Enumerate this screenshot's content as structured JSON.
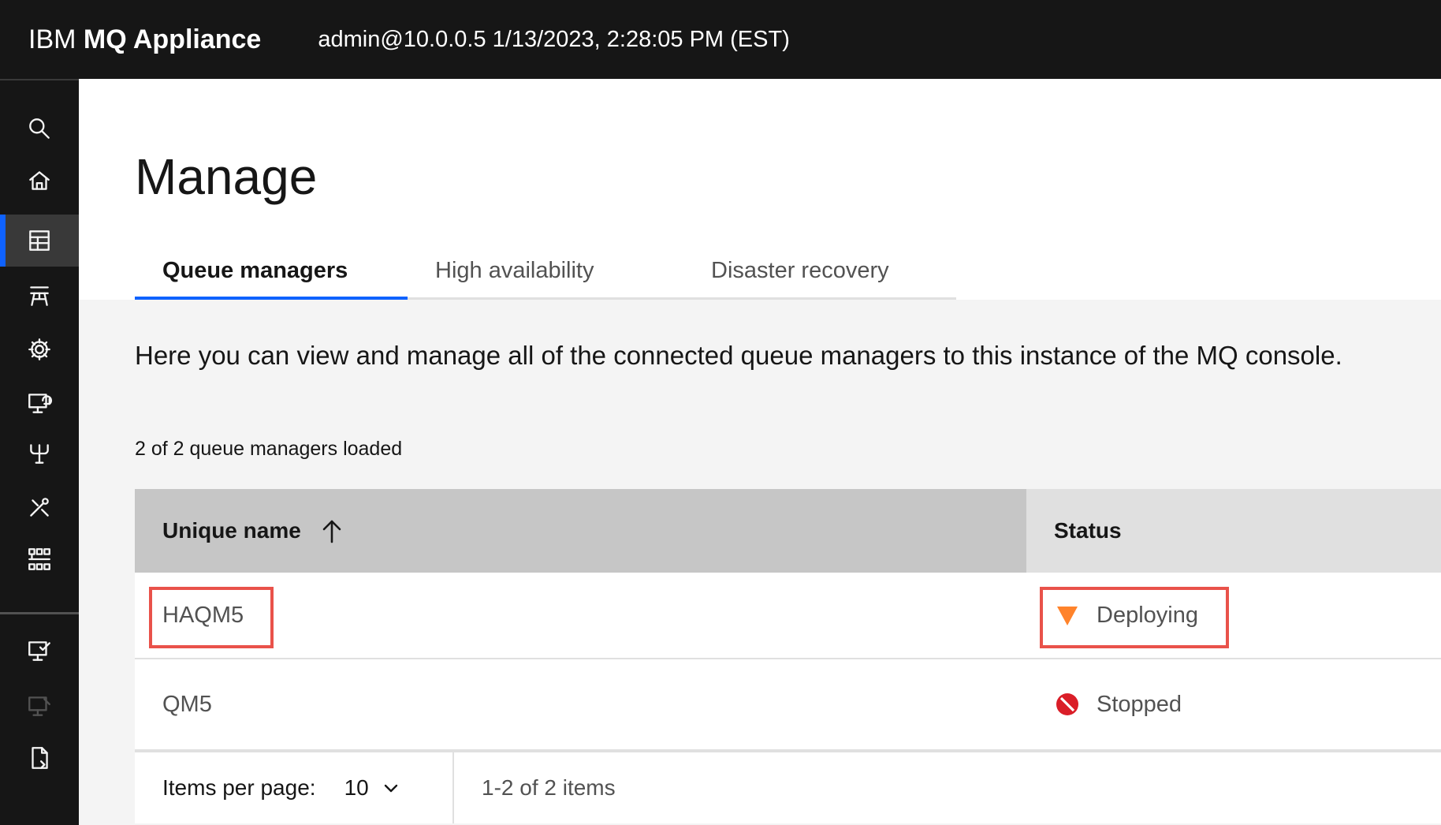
{
  "header": {
    "brand_prefix": "IBM",
    "brand_name": "MQ Appliance",
    "session": "admin@10.0.0.5 1/13/2023, 2:28:05 PM (EST)"
  },
  "sidenav": {
    "items": [
      {
        "icon": "search-icon"
      },
      {
        "icon": "home-icon"
      },
      {
        "icon": "table-icon",
        "active": true
      },
      {
        "icon": "network-icon"
      },
      {
        "icon": "gear-icon"
      },
      {
        "icon": "monitor-sync-icon"
      },
      {
        "icon": "fork-icon"
      },
      {
        "icon": "tools-icon"
      },
      {
        "icon": "topology-icon"
      },
      {
        "icon": "monitor-check-icon"
      },
      {
        "icon": "monitor-disabled-icon",
        "disabled": true
      },
      {
        "icon": "document-icon"
      }
    ]
  },
  "page": {
    "title": "Manage",
    "tabs": [
      "Queue managers",
      "High availability",
      "Disaster recovery"
    ],
    "description": "Here you can view and manage all of the connected queue managers to this instance of the MQ console.",
    "loaded_count": "2 of 2 queue managers loaded"
  },
  "table": {
    "columns": [
      "Unique name",
      "Status"
    ],
    "rows": [
      {
        "name": "HAQM5",
        "status": "Deploying",
        "status_color": "#ff832b"
      },
      {
        "name": "QM5",
        "status": "Stopped",
        "status_color": "#da1e28"
      }
    ],
    "items_per_page_label": "Items per page:",
    "items_per_page_value": "10",
    "range": "1-2 of 2 items"
  },
  "colors": {
    "header_bg": "#161616",
    "accent": "#0f62fe",
    "highlight": "#e9524a"
  }
}
